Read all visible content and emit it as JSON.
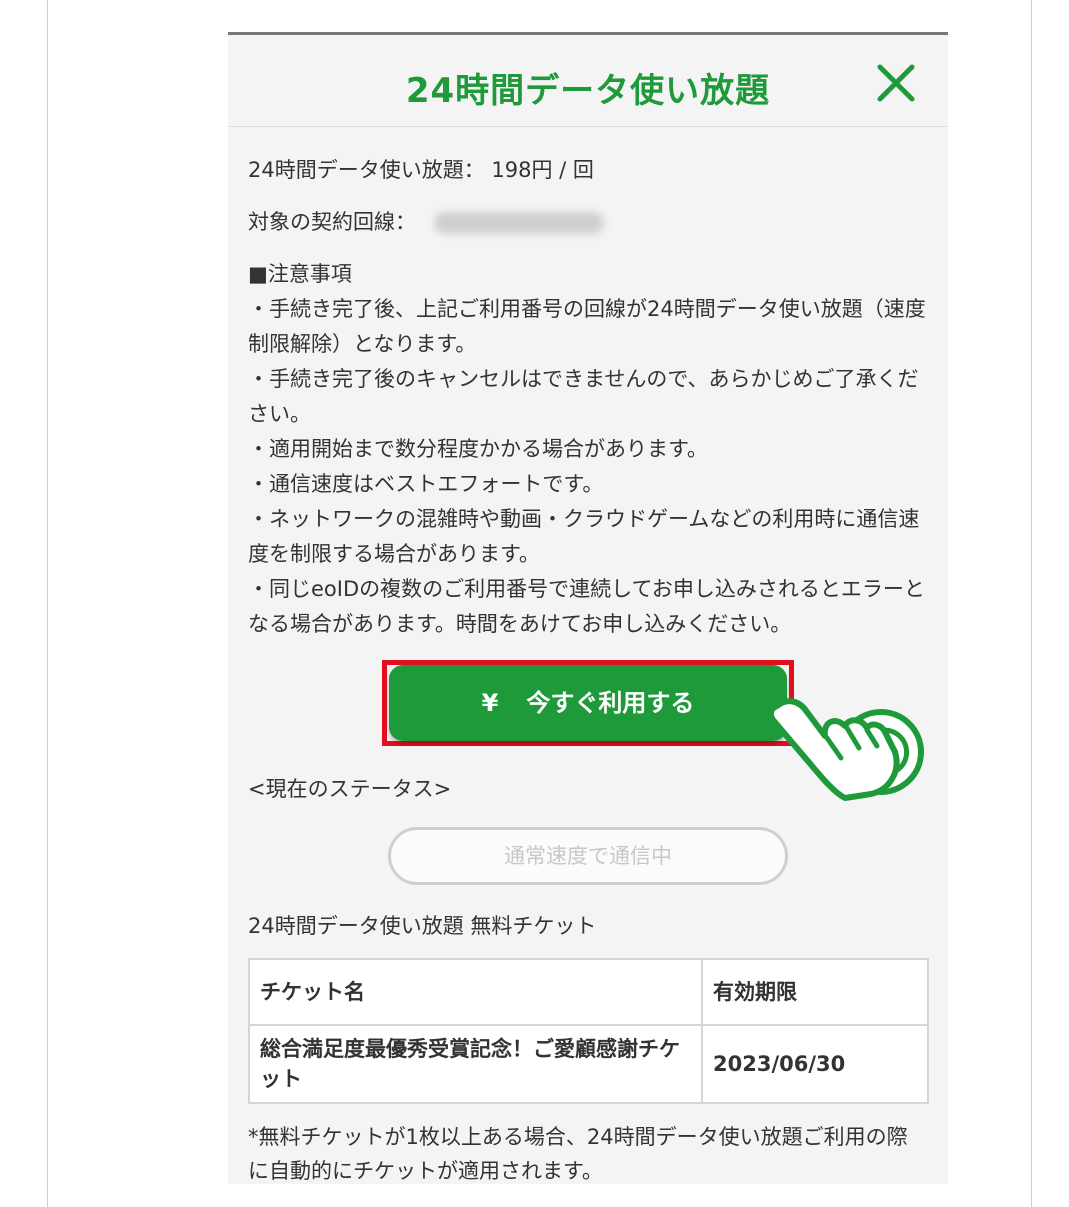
{
  "header": {
    "title": "24時間データ使い放題",
    "close_icon": "close-icon"
  },
  "info": {
    "price_line": "24時間データ使い放題： 198円 / 回",
    "line_label": "対象の契約回線："
  },
  "notes": {
    "heading": "■注意事項",
    "items": [
      "・手続き完了後、上記ご利用番号の回線が24時間データ使い放題（速度制限解除）となります。",
      "・手続き完了後のキャンセルはできませんので、あらかじめご了承ください。",
      "・適用開始まで数分程度かかる場合があります。",
      "・通信速度はベストエフォートです。",
      "・ネットワークの混雑時や動画・クラウドゲームなどの利用時に通信速度を制限する場合があります。",
      "・同じeoIDの複数のご利用番号で連続してお申し込みされるとエラーとなる場合があります。時間をあけてお申し込みください。"
    ]
  },
  "cta": {
    "yen_symbol": "¥",
    "label": "今すぐ利用する",
    "highlight_color": "#e20f1f",
    "button_color": "#1f9a3a"
  },
  "status": {
    "label": "<現在のステータス>",
    "value": "通常速度で通信中"
  },
  "tickets": {
    "title": "24時間データ使い放題 無料チケット",
    "columns": [
      "チケット名",
      "有効期限"
    ],
    "rows": [
      [
        "総合満足度最優秀受賞記念！ご愛顧感謝チケット",
        "2023/06/30"
      ]
    ],
    "footnote": "*無料チケットが1枚以上ある場合、24時間データ使い放題ご利用の際に自動的にチケットが適用されます。"
  },
  "colors": {
    "accent_green": "#1f9a3a",
    "highlight_red": "#e20f1f"
  }
}
